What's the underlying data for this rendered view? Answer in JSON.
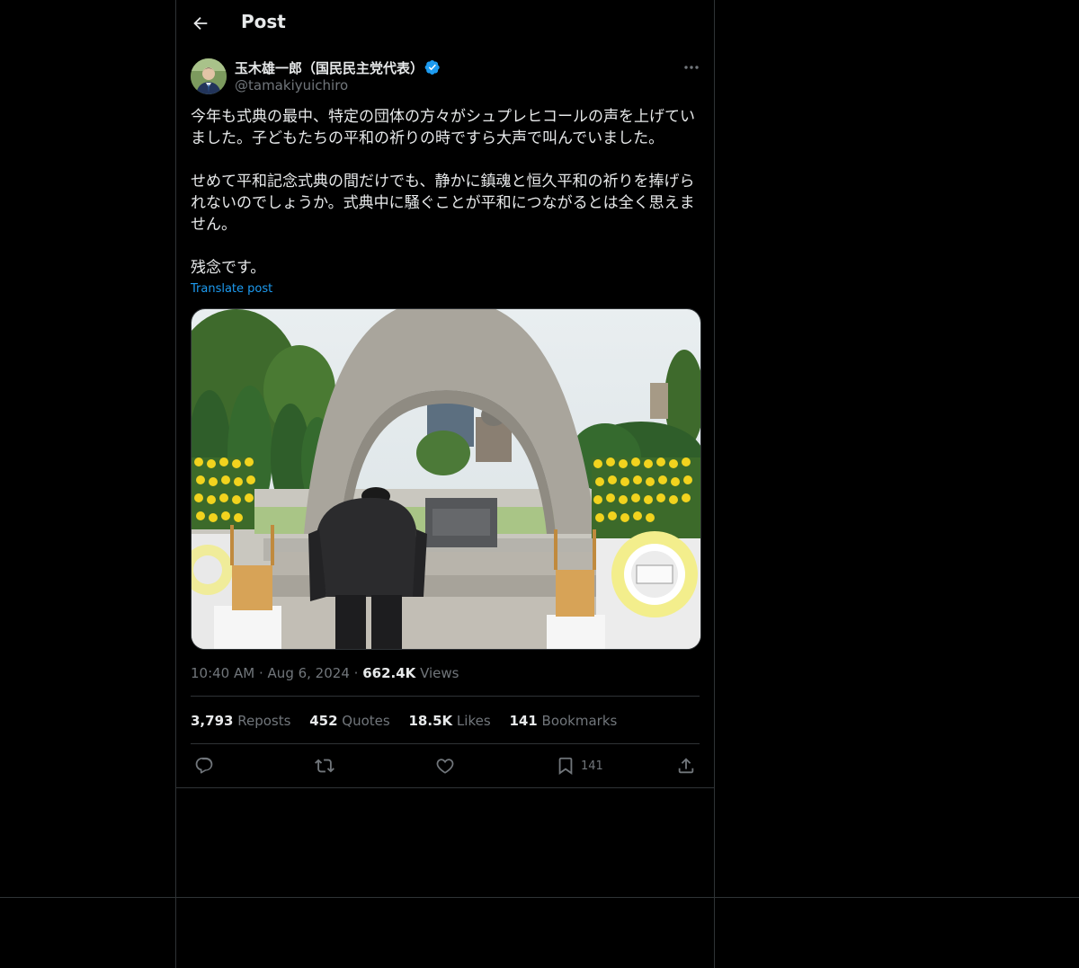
{
  "header": {
    "title": "Post"
  },
  "author": {
    "name": "玉木雄一郎（国民民主党代表）",
    "handle": "@tamakiyuichiro"
  },
  "post": {
    "paragraphs": [
      "今年も式典の最中、特定の団体の方々がシュプレヒコールの声を上げていました。子どもたちの平和の祈りの時ですら大声で叫んでいました。",
      "せめて平和記念式典の間だけでも、静かに鎮魂と恒久平和の祈りを捧げられないのでしょうか。式典中に騒ぐことが平和につながるとは全く思えません。",
      "残念です。"
    ],
    "translate_label": "Translate post",
    "time": "10:40 AM",
    "date": "Aug 6, 2024",
    "views_count": "662.4K",
    "views_label": "Views",
    "separator": "·"
  },
  "stats": {
    "reposts": {
      "count": "3,793",
      "label": "Reposts"
    },
    "quotes": {
      "count": "452",
      "label": "Quotes"
    },
    "likes": {
      "count": "18.5K",
      "label": "Likes"
    },
    "bookmarks": {
      "count": "141",
      "label": "Bookmarks"
    }
  },
  "actions": {
    "bookmark_count": "141"
  },
  "icons": {
    "back": "back-arrow-icon",
    "verified": "verified-badge-icon",
    "more": "more-icon",
    "reply": "reply-icon",
    "repost": "repost-icon",
    "like": "like-icon",
    "bookmark": "bookmark-icon",
    "share": "share-icon"
  },
  "colors": {
    "background": "#000000",
    "text": "#e7e9ea",
    "muted": "#71767b",
    "accent": "#1d9bf0",
    "border": "#2f3336"
  }
}
